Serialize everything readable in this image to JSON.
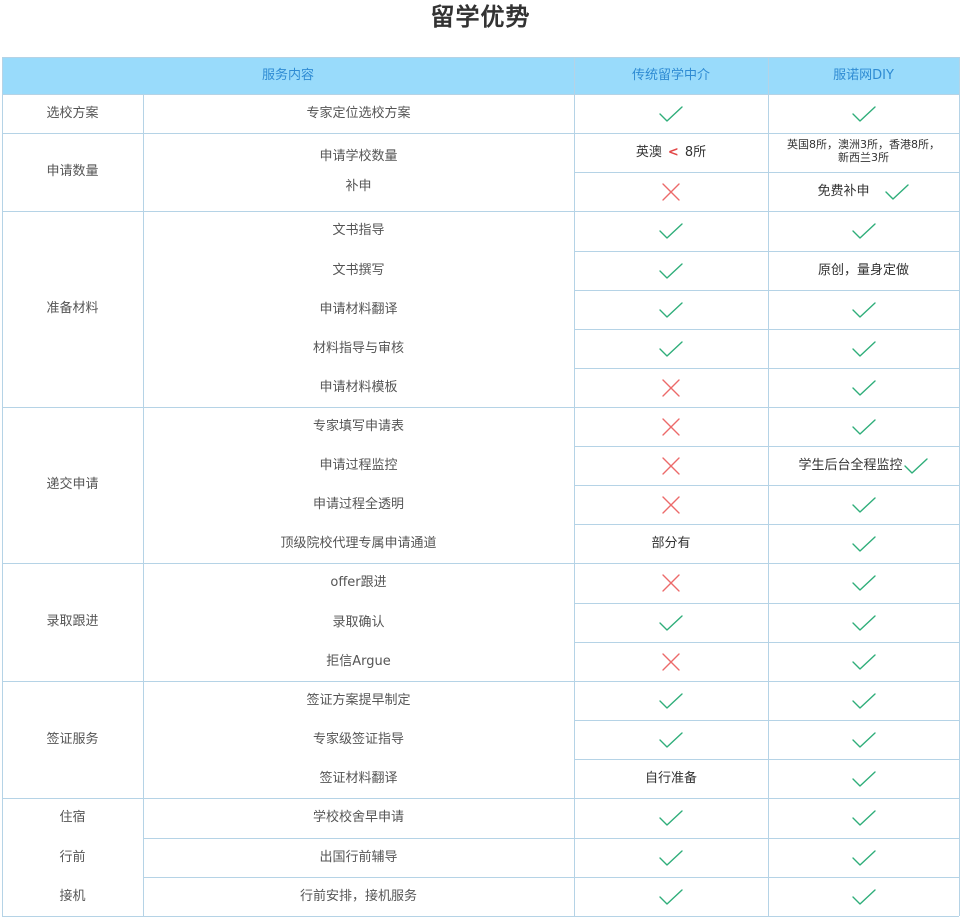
{
  "title": "留学优势",
  "headers": {
    "content": "服务内容",
    "traditional": "传统留学中介",
    "diy": "服诺网DIY"
  },
  "categories": {
    "school": "选校方案",
    "count": "申请数量",
    "materials": "准备材料",
    "submit": "递交申请",
    "admit": "录取跟进",
    "visa": "签证服务",
    "stay": "住宿",
    "predepart": "行前",
    "pickup": "接机"
  },
  "rows": [
    {
      "item": "专家定位选校方案",
      "trad": "✓",
      "diy": "✓"
    },
    {
      "item": "申请学校数量",
      "trad": "英澳 < 8所",
      "diy": "英国8所，澳洲3所，香港8所，新西兰3所"
    },
    {
      "item": "补申",
      "trad": "✗",
      "diy": "免费补申 ✓"
    },
    {
      "item": "文书指导",
      "trad": "✓",
      "diy": "✓"
    },
    {
      "item": "文书撰写",
      "trad": "✓",
      "diy": "原创，量身定做"
    },
    {
      "item": "申请材料翻译",
      "trad": "✓",
      "diy": "✓"
    },
    {
      "item": "材料指导与审核",
      "trad": "✓",
      "diy": "✓"
    },
    {
      "item": "申请材料模板",
      "trad": "✗",
      "diy": "✓"
    },
    {
      "item": "专家填写申请表",
      "trad": "✗",
      "diy": "✓"
    },
    {
      "item": "申请过程监控",
      "trad": "✗",
      "diy": "学生后台全程监控 ✓"
    },
    {
      "item": "申请过程全透明",
      "trad": "✗",
      "diy": "✓"
    },
    {
      "item": "顶级院校代理专属申请通道",
      "trad": "部分有",
      "diy": "✓"
    },
    {
      "item": "offer跟进",
      "trad": "✗",
      "diy": "✓"
    },
    {
      "item": "录取确认",
      "trad": "✓",
      "diy": "✓"
    },
    {
      "item": "拒信Argue",
      "trad": "✗",
      "diy": "✓"
    },
    {
      "item": "签证方案提早制定",
      "trad": "✓",
      "diy": "✓"
    },
    {
      "item": "专家级签证指导",
      "trad": "✓",
      "diy": "✓"
    },
    {
      "item": "签证材料翻译",
      "trad": "自行准备",
      "diy": "✓"
    },
    {
      "item": "学校校舍早申请",
      "trad": "✓",
      "diy": "✓"
    },
    {
      "item": "出国行前辅导",
      "trad": "✓",
      "diy": "✓"
    },
    {
      "item": "行前安排，接机服务",
      "trad": "✓",
      "diy": "✓"
    }
  ],
  "texts": {
    "count_trad_prefix": "英澳",
    "count_trad_lt": "<",
    "count_trad_suffix": "8所",
    "count_diy_line1": "英国8所，澳洲3所，香港8所，",
    "count_diy_line2": "新西兰3所",
    "supp_diy": "免费补申",
    "essay_diy": "原创，量身定做",
    "monitor_diy": "学生后台全程监控",
    "channel_trad": "部分有",
    "visa_trans_trad": "自行准备"
  },
  "colors": {
    "header_bg": "#99dbfb",
    "header_text": "#2e8bd3",
    "check": "#2fae7a",
    "cross": "#ec6a6a",
    "border": "#b5d3e6"
  }
}
